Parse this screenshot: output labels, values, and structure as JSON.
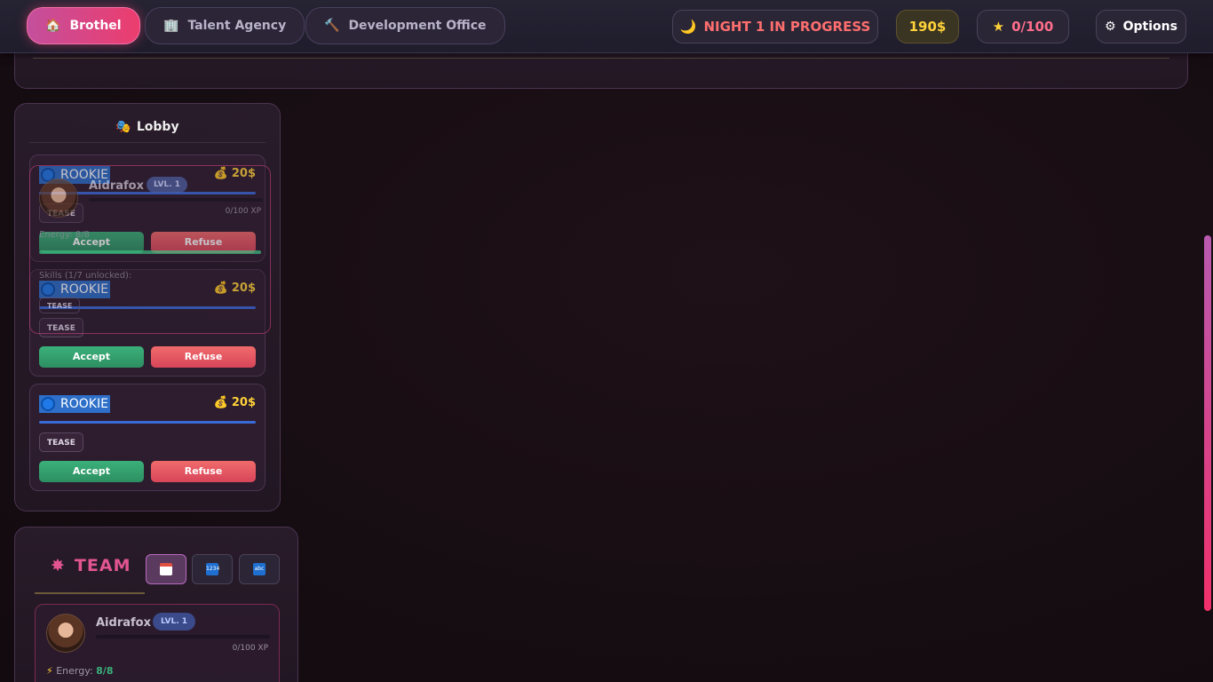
{
  "nav": {
    "tabs": [
      {
        "label": "Brothel",
        "icon": "house-icon",
        "active": true
      },
      {
        "label": "Talent Agency",
        "icon": "building-icon",
        "active": false
      },
      {
        "label": "Development Office",
        "icon": "hammer-icon",
        "active": false
      }
    ]
  },
  "status": {
    "night": "NIGHT 1 IN PROGRESS",
    "money": "190$",
    "stars": "0/100",
    "options": "Options"
  },
  "colors": {
    "accent": "#ec3d6e",
    "money": "#ffd23a",
    "accept": "#3bb07a",
    "refuse": "#f06b6b",
    "rank": "#2d6fc9"
  },
  "lobby": {
    "title": "Lobby",
    "requests": [
      {
        "rank": "ROOKIE",
        "reward": "20$",
        "skill": "TEASE",
        "accept": "Accept",
        "refuse": "Refuse"
      },
      {
        "rank": "ROOKIE",
        "reward": "20$",
        "skill": "TEASE",
        "accept": "Accept",
        "refuse": "Refuse"
      },
      {
        "rank": "ROOKIE",
        "reward": "20$",
        "skill": "TEASE",
        "accept": "Accept",
        "refuse": "Refuse"
      }
    ]
  },
  "dragged_card": {
    "name": "Aidrafox",
    "level": "LVL. 1",
    "xp": "0/100 XP",
    "xp_fraction": 0,
    "energy": "Energy: 8/8",
    "skills": "Skills (1/7 unlocked):",
    "skill": "TEASE"
  },
  "team": {
    "title": "TEAM",
    "tabs": [
      {
        "name": "calendar-icon",
        "active": true
      },
      {
        "name": "number-grid-icon",
        "active": false
      },
      {
        "name": "abc-icon",
        "active": false
      }
    ],
    "member": {
      "name": "Aidrafox",
      "level": "LVL. 1",
      "xp": "0/100 XP",
      "xp_fraction": 0,
      "energy_label": "Energy:",
      "energy_value": "8/8"
    }
  }
}
